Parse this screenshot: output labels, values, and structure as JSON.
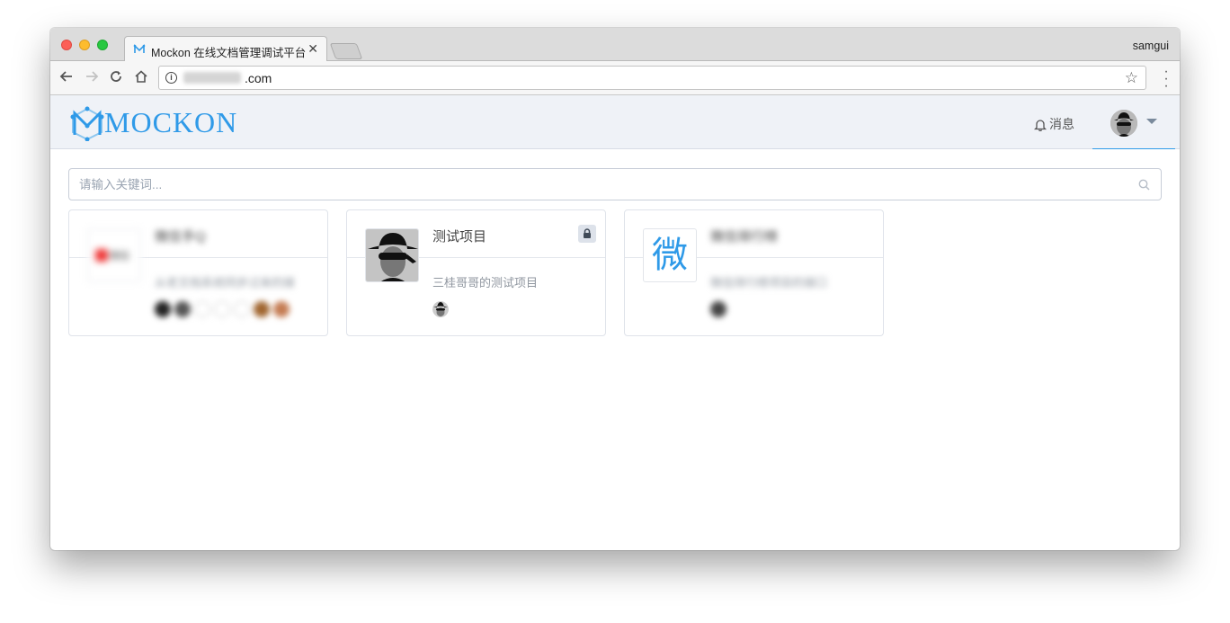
{
  "browser": {
    "tab_title": "Mockon 在线文档管理调试平台",
    "profile_name": "samgui",
    "url_suffix": ".com",
    "icons": [
      "favicon-icon",
      "close-icon",
      "back-icon",
      "forward-icon",
      "reload-icon",
      "home-icon",
      "info-icon",
      "star-icon",
      "menu-icon"
    ]
  },
  "header": {
    "logo_text": "MOCKON",
    "notifications_label": "消息"
  },
  "search": {
    "placeholder": "请输入关键词..."
  },
  "projects": [
    {
      "title": "微信手Q",
      "description": "从老文档系统同步过来的接",
      "thumb": "微信",
      "blurred": true,
      "member_count": 7
    },
    {
      "title": "测试项目",
      "description": "三桂哥哥的测试项目",
      "private": true,
      "member_count": 1
    },
    {
      "title": "微信排行榜",
      "description": "微信排行榜项目的接口",
      "thumb": "微",
      "blurred": true,
      "member_count": 1
    }
  ],
  "colors": {
    "accent": "#2f9ae8",
    "header_bg": "#eff2f7"
  }
}
